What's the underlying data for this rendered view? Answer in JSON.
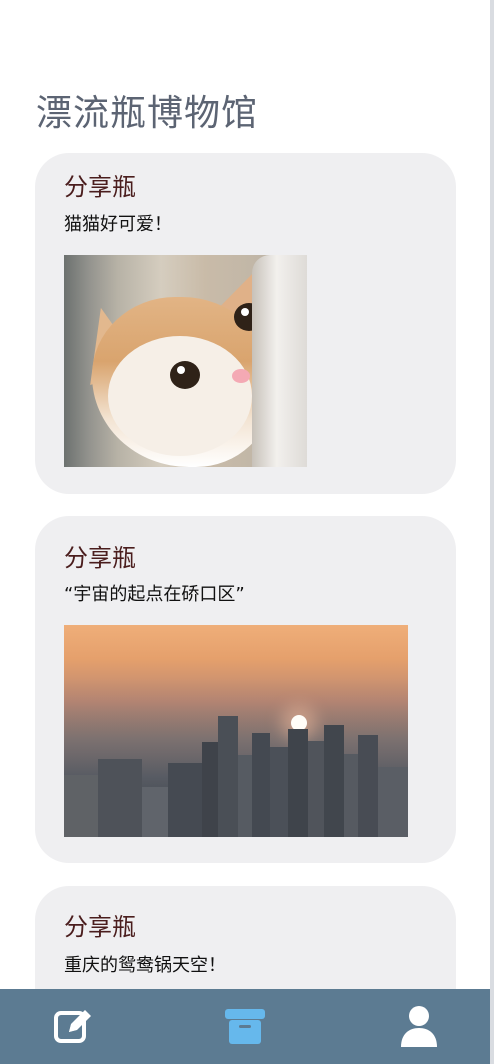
{
  "page": {
    "title": "漂流瓶博物馆"
  },
  "cards": [
    {
      "title": "分享瓶",
      "text": "猫猫好可爱！"
    },
    {
      "title": "分享瓶",
      "text": "“宇宙的起点在硚口区”"
    },
    {
      "title": "分享瓶",
      "text": "重庆的鸳鸯锅天空！"
    }
  ],
  "bottom_nav": {
    "items": [
      {
        "icon": "edit-icon",
        "active": false
      },
      {
        "icon": "archive-icon",
        "active": true
      },
      {
        "icon": "user-icon",
        "active": false
      }
    ]
  },
  "colors": {
    "title": "#5c6473",
    "card_background": "#efeff1",
    "card_title": "#4a1d1d",
    "bottom_bar": "#5c7b92",
    "active_icon": "#66b8ec",
    "inactive_icon": "#ffffff"
  }
}
